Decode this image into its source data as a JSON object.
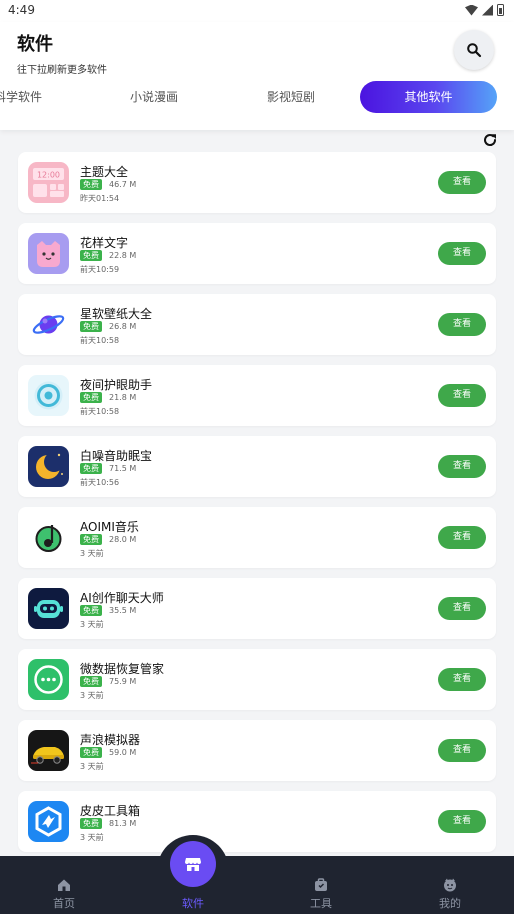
{
  "status_bar": {
    "time": "4:49"
  },
  "header": {
    "title": "软件",
    "subtitle": "往下拉刷新更多软件"
  },
  "tabs": [
    {
      "label": "科学软件",
      "active": false
    },
    {
      "label": "小说漫画",
      "active": false
    },
    {
      "label": "影视短剧",
      "active": false
    },
    {
      "label": "其他软件",
      "active": true
    }
  ],
  "apps": [
    {
      "name": "主题大全",
      "badge": "免费",
      "size": "46.7 M",
      "time": "昨天01:54",
      "button": "查看",
      "icon": "theme-app-icon"
    },
    {
      "name": "花样文字",
      "badge": "免费",
      "size": "22.8 M",
      "time": "前天10:59",
      "button": "查看",
      "icon": "cat-app-icon"
    },
    {
      "name": "星软壁纸大全",
      "badge": "免费",
      "size": "26.8 M",
      "time": "前天10:58",
      "button": "查看",
      "icon": "planet-app-icon"
    },
    {
      "name": "夜间护眼助手",
      "badge": "免费",
      "size": "21.8 M",
      "time": "前天10:58",
      "button": "查看",
      "icon": "eye-app-icon"
    },
    {
      "name": "白噪音助眠宝",
      "badge": "免费",
      "size": "71.5 M",
      "time": "前天10:56",
      "button": "查看",
      "icon": "moon-app-icon"
    },
    {
      "name": "AOIMI音乐",
      "badge": "免费",
      "size": "28.0 M",
      "time": "3 天前",
      "button": "查看",
      "icon": "music-app-icon"
    },
    {
      "name": "AI创作聊天大师",
      "badge": "免费",
      "size": "35.5 M",
      "time": "3 天前",
      "button": "查看",
      "icon": "robot-app-icon"
    },
    {
      "name": "微数据恢复管家",
      "badge": "免费",
      "size": "75.9 M",
      "time": "3 天前",
      "button": "查看",
      "icon": "chat-recovery-app-icon"
    },
    {
      "name": "声浪模拟器",
      "badge": "免费",
      "size": "59.0 M",
      "time": "3 天前",
      "button": "查看",
      "icon": "car-app-icon"
    },
    {
      "name": "皮皮工具箱",
      "badge": "免费",
      "size": "81.3 M",
      "time": "3 天前",
      "button": "查看",
      "icon": "toolbox-app-icon"
    }
  ],
  "bottom_nav": [
    {
      "label": "首页",
      "icon": "home-icon",
      "active": false
    },
    {
      "label": "软件",
      "icon": "store-icon",
      "active": true
    },
    {
      "label": "工具",
      "icon": "toolbox-icon",
      "active": false
    },
    {
      "label": "我的",
      "icon": "profile-icon",
      "active": false
    }
  ],
  "colors": {
    "accent": "#6a4cf3",
    "view_button": "#3fa84a",
    "free_badge": "#3bb24b",
    "nav_background": "#1f2430"
  }
}
